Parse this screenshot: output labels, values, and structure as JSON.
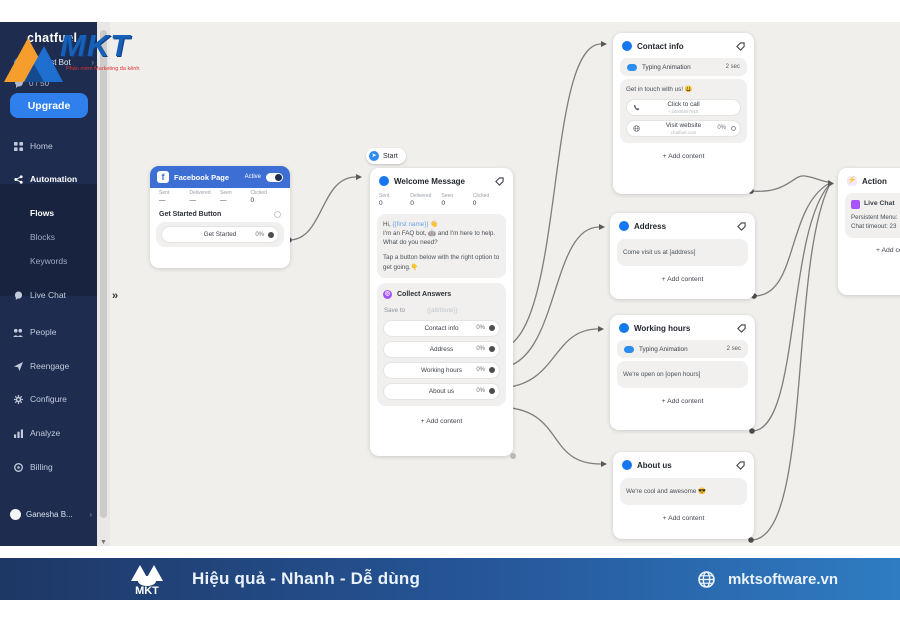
{
  "watermark": {
    "brand": "MKT",
    "tagline": "Phần mềm Marketing đa kênh"
  },
  "sidebar": {
    "logo": "chatfuel",
    "bot_name": "My First Bot",
    "usage": "0 / 50",
    "upgrade_label": "Upgrade",
    "items": [
      {
        "label": "Home"
      },
      {
        "label": "Automation"
      },
      {
        "label": "Live Chat"
      },
      {
        "label": "People"
      },
      {
        "label": "Reengage"
      },
      {
        "label": "Configure"
      },
      {
        "label": "Analyze"
      },
      {
        "label": "Billing"
      }
    ],
    "sub_items": [
      {
        "label": "Flows"
      },
      {
        "label": "Blocks"
      },
      {
        "label": "Keywords"
      }
    ],
    "account": "Ganesha B..."
  },
  "canvas": {
    "start_label": "Start",
    "facebook": {
      "title": "Facebook Page",
      "status": "Active",
      "stats": [
        {
          "label": "Sent",
          "value": "—"
        },
        {
          "label": "Delivered",
          "value": "—"
        },
        {
          "label": "Seen",
          "value": "—"
        },
        {
          "label": "Clicked",
          "value": "0"
        }
      ],
      "section_label": "Get Started Button",
      "button": {
        "label": "Get Started",
        "percent": "0%"
      }
    },
    "welcome": {
      "title": "Welcome Message",
      "stats": [
        {
          "label": "Sent",
          "value": "0"
        },
        {
          "label": "Delivered",
          "value": "0"
        },
        {
          "label": "Seen",
          "value": "0"
        },
        {
          "label": "Clicked",
          "value": "0"
        }
      ],
      "msg_line1_prefix": "Hi, ",
      "msg_line1_var": "{{first name}}",
      "msg_line1_emoji": " 👋",
      "msg_line2": "I'm an FAQ bot, 🤖 and I'm here to help. What do you need?",
      "msg_line3": "Tap a button below with the right option to get going.👇",
      "collect": {
        "title": "Collect Answers",
        "save_label": "Save to",
        "attribute": "{{attribute}}"
      },
      "buttons": [
        {
          "label": "Contact info",
          "percent": "0%"
        },
        {
          "label": "Address",
          "percent": "0%"
        },
        {
          "label": "Working hours",
          "percent": "0%"
        },
        {
          "label": "About us",
          "percent": "0%"
        }
      ],
      "add_content": "+ Add content"
    },
    "contact": {
      "title": "Contact info",
      "typing": {
        "label": "Typing Animation",
        "duration": "2 sec"
      },
      "message": "Get in touch with us! 😃",
      "buttons": [
        {
          "label": "Click to call",
          "sub": "+18005557615"
        },
        {
          "label": "Visit website",
          "sub": "chatfuel.com",
          "percent": "0%"
        }
      ],
      "add_content": "+ Add content"
    },
    "address": {
      "title": "Address",
      "message": "Come visit us at [address]",
      "add_content": "+ Add content"
    },
    "working": {
      "title": "Working hours",
      "typing": {
        "label": "Typing Animation",
        "duration": "2 sec"
      },
      "message": "We're open on [open hours]",
      "add_content": "+ Add content"
    },
    "about": {
      "title": "About us",
      "message": "We're cool and awesome 😎",
      "add_content": "+ Add content"
    },
    "action": {
      "title": "Action",
      "chip": "Live Chat",
      "line1": "Persistent Menu:",
      "line2": "Chat timeout: 23",
      "add_content": "+ Add content"
    }
  },
  "footer": {
    "brand": "MKT",
    "slogan": "Hiệu quả - Nhanh - Dễ dùng",
    "website": "mktsoftware.vn"
  },
  "colors": {
    "sidebar_navy": "#1d2c4f",
    "canvas_gray": "#f1efec",
    "accent_blue": "#2f80ed",
    "facebook_header": "#3d6ed3",
    "messenger_blue": "#1677f0",
    "action_purple": "#a855f7",
    "footer_gradient_left": "#1e3765",
    "footer_gradient_right": "#2f7cc3",
    "wire_gray": "#7d7d7d"
  }
}
